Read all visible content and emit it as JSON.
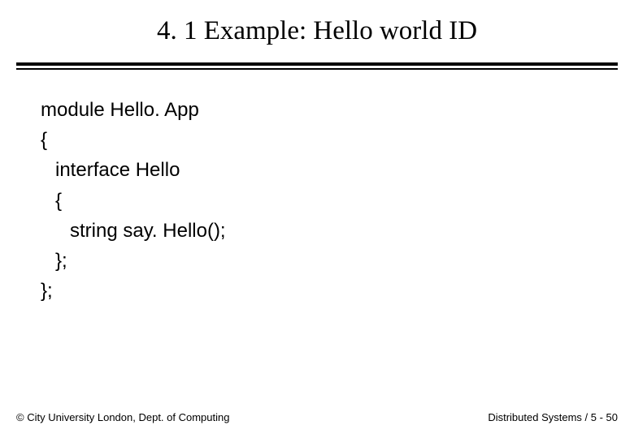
{
  "title": "4. 1 Example: Hello world ID",
  "code": {
    "l1": "module Hello. App",
    "l2": "{",
    "l3": "interface Hello",
    "l4": "{",
    "l5": "string say. Hello();",
    "l6": "};",
    "l7": "};"
  },
  "footer": {
    "left": "© City University London, Dept. of Computing",
    "right": "Distributed Systems / 5 - 50"
  }
}
